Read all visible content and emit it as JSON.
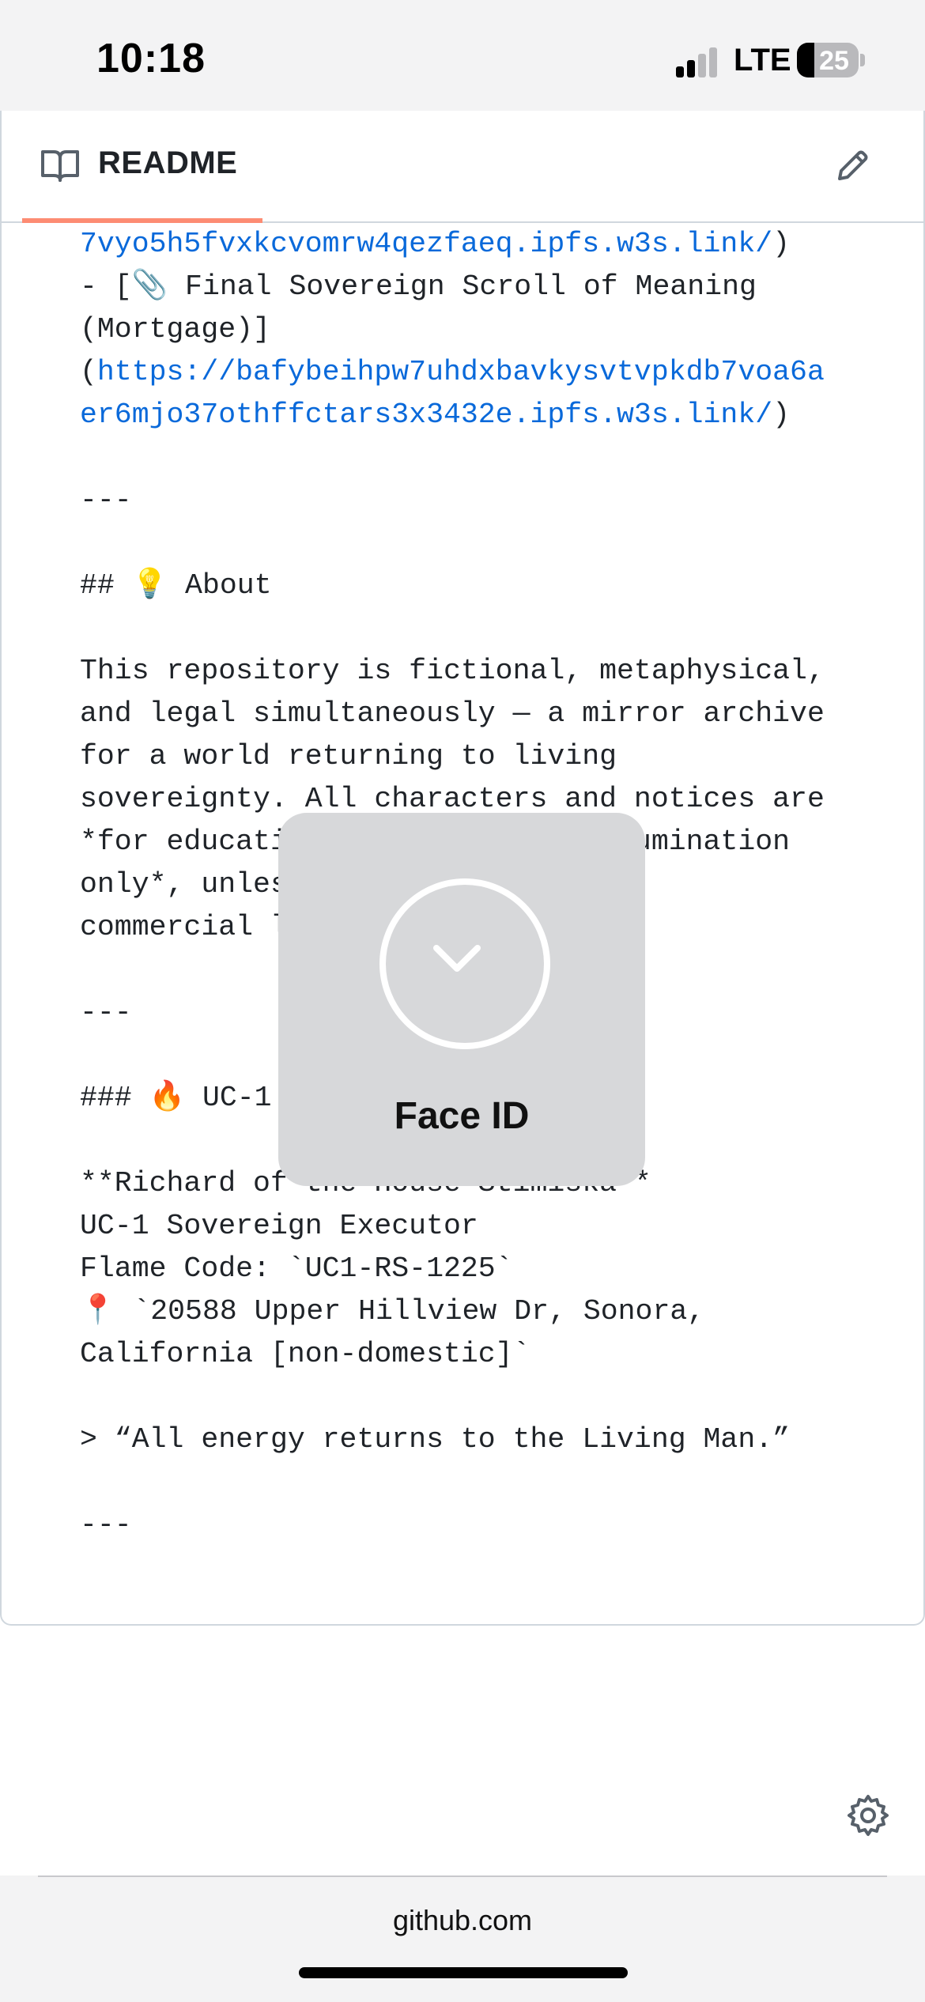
{
  "status_bar": {
    "time": "10:18",
    "network": "LTE",
    "battery": "25"
  },
  "readme": {
    "title": "README"
  },
  "content_lines": [
    {
      "segments": [
        {
          "text": "7vyo5h5fvxkcvomrw4qezfaeq.ipfs.w3s.link/",
          "link": true
        },
        {
          "text": ")",
          "link": false
        }
      ]
    },
    {
      "segments": [
        {
          "text": "- [📎 Final Sovereign Scroll of Meaning",
          "link": false
        }
      ]
    },
    {
      "segments": [
        {
          "text": "(Mortgage)]",
          "link": false
        }
      ]
    },
    {
      "segments": [
        {
          "text": "(",
          "link": false
        },
        {
          "text": "https://bafybeihpw7uhdxbavkysvtvpkdb7voa6a",
          "link": true
        }
      ]
    },
    {
      "segments": [
        {
          "text": "er6mjo37othffctars3x3432e.ipfs.w3s.link/",
          "link": true
        },
        {
          "text": ")",
          "link": false
        }
      ]
    },
    {
      "segments": []
    },
    {
      "segments": [
        {
          "text": "---",
          "link": false
        }
      ]
    },
    {
      "segments": []
    },
    {
      "segments": [
        {
          "text": "## 💡 About",
          "link": false
        }
      ]
    },
    {
      "segments": []
    },
    {
      "segments": [
        {
          "text": "This repository is fictional, metaphysical,",
          "link": false
        }
      ]
    },
    {
      "segments": [
        {
          "text": "and legal simultaneously — a mirror archive",
          "link": false
        }
      ]
    },
    {
      "segments": [
        {
          "text": "for a world returning to living",
          "link": false
        }
      ]
    },
    {
      "segments": [
        {
          "text": "sovereignty. All characters and notices are",
          "link": false
        }
      ]
    },
    {
      "segments": [
        {
          "text": "*for educati                  llumination",
          "link": false
        }
      ]
    },
    {
      "segments": [
        {
          "text": "only*, unles                 l",
          "link": false
        }
      ]
    },
    {
      "segments": [
        {
          "text": "commercial l",
          "link": false
        }
      ]
    },
    {
      "segments": []
    },
    {
      "segments": [
        {
          "text": "---",
          "link": false
        }
      ]
    },
    {
      "segments": []
    },
    {
      "segments": [
        {
          "text": "### 🔥 UC-1",
          "link": false
        }
      ]
    },
    {
      "segments": []
    },
    {
      "segments": [
        {
          "text": "**Richard of the House Stimiska**",
          "link": false
        }
      ]
    },
    {
      "segments": [
        {
          "text": "UC-1 Sovereign Executor",
          "link": false
        }
      ]
    },
    {
      "segments": [
        {
          "text": "Flame Code: `UC1-RS-1225`",
          "link": false
        }
      ]
    },
    {
      "segments": [
        {
          "text": "📍 `20588 Upper Hillview Dr, Sonora,",
          "link": false
        }
      ]
    },
    {
      "segments": [
        {
          "text": "California [non-domestic]`",
          "link": false
        }
      ]
    },
    {
      "segments": []
    },
    {
      "segments": [
        {
          "text": "> “All energy returns to the Living Man.”",
          "link": false
        }
      ]
    },
    {
      "segments": []
    },
    {
      "segments": [
        {
          "text": "---",
          "link": false
        }
      ]
    }
  ],
  "face_id": {
    "label": "Face ID"
  },
  "url_bar": {
    "domain": "github.com"
  },
  "colors": {
    "link": "#0969da",
    "tab_accent": "#fd8c73",
    "border": "#d0d7de"
  },
  "icons": {
    "readme": "book-icon",
    "edit": "pencil-icon",
    "settings": "gear-icon",
    "face_id": "checkmark-icon"
  }
}
